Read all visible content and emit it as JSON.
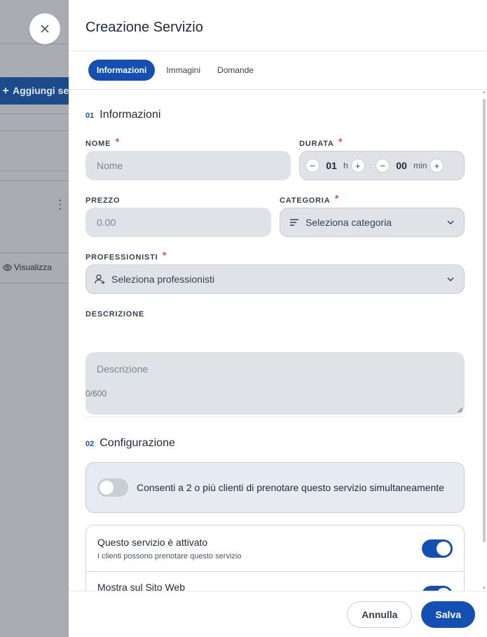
{
  "background": {
    "add_button_label": "Aggiungi se",
    "view_label": "Visualizza"
  },
  "drawer": {
    "title": "Creazione Servizio",
    "tabs": [
      {
        "label": "Informazioni",
        "active": true
      },
      {
        "label": "Immagini",
        "active": false
      },
      {
        "label": "Domande",
        "active": false
      }
    ]
  },
  "sections": {
    "info": {
      "number": "01",
      "title": "Informazioni"
    },
    "config": {
      "number": "02",
      "title": "Configurazione"
    }
  },
  "form": {
    "nome": {
      "label": "NOME",
      "required_mark": "*",
      "placeholder": "Nome"
    },
    "durata": {
      "label": "DURATA",
      "required_mark": "*",
      "hours": "01",
      "hours_unit": "h",
      "minutes": "00",
      "minutes_unit": "min",
      "separator": ":",
      "minus": "−",
      "plus": "+"
    },
    "prezzo": {
      "label": "PREZZO",
      "placeholder": "0.00"
    },
    "categoria": {
      "label": "CATEGORIA",
      "required_mark": "*",
      "placeholder": "Seleziona categoria"
    },
    "professionisti": {
      "label": "PROFESSIONISTI",
      "required_mark": "*",
      "placeholder": "Seleziona professionisti"
    },
    "descrizione": {
      "label": "DESCRIZIONE",
      "placeholder": "Descrizione",
      "counter": "0/600"
    }
  },
  "config": {
    "simultaneous": {
      "text": "Consenti a 2 o più clienti di prenotare questo servizio simultaneamente",
      "enabled": false
    },
    "rows": [
      {
        "title": "Questo servizio è attivato",
        "subtitle": "I clienti possono prenotare questo servizio",
        "enabled": true
      },
      {
        "title": "Mostra sul Sito Web",
        "subtitle": "",
        "enabled": true
      }
    ]
  },
  "footer": {
    "cancel_label": "Annulla",
    "save_label": "Salva"
  },
  "colors": {
    "primary": "#1450b4",
    "required": "#d32f2f",
    "field_bg": "#dfe3e8"
  }
}
